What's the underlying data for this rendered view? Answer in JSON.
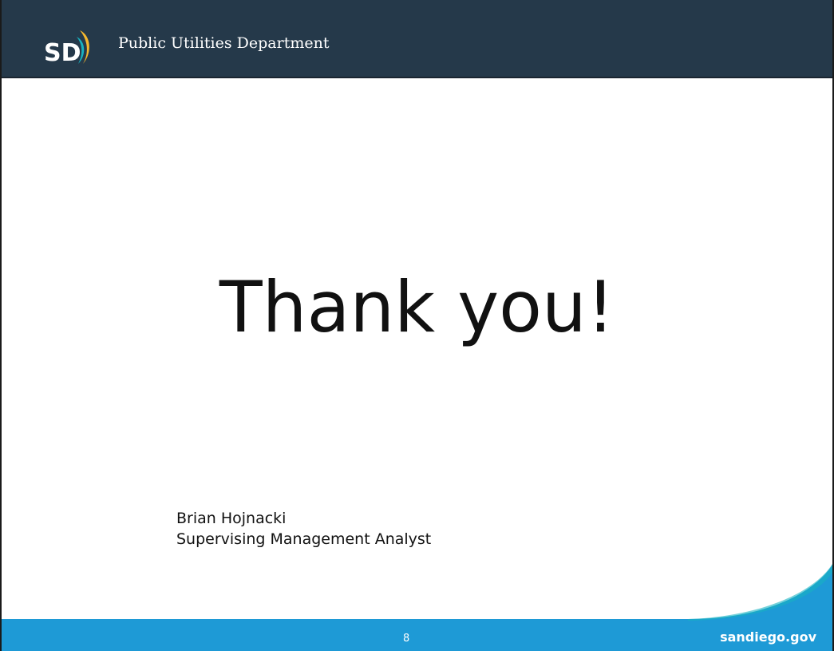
{
  "header": {
    "logo_text": "SD",
    "title": "Public Utilities Department"
  },
  "main": {
    "headline": "Thank you!",
    "presenter_name": "Brian Hojnacki",
    "presenter_role": "Supervising Management Analyst"
  },
  "footer": {
    "page_number": "8",
    "site": "sandiego.gov"
  },
  "colors": {
    "header_bg": "#25394a",
    "footer_blue": "#1e9ad6",
    "accent_teal": "#17b3c2",
    "accent_yellow": "#f5b82e"
  }
}
